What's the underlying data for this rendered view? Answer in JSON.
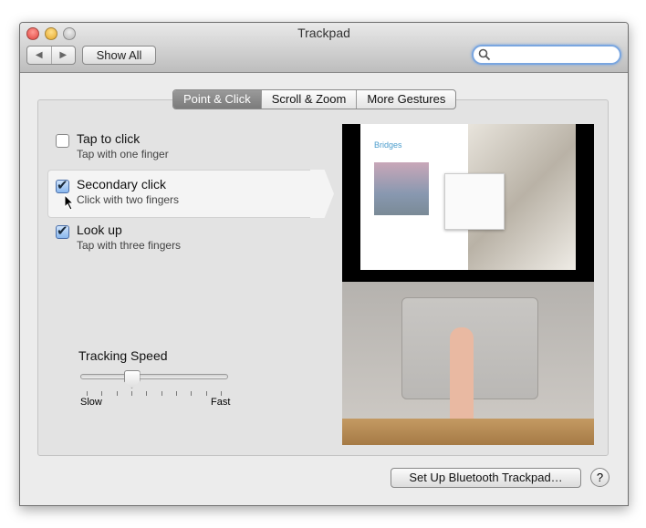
{
  "window": {
    "title": "Trackpad",
    "show_all": "Show All",
    "search_placeholder": ""
  },
  "tabs": [
    {
      "label": "Point & Click",
      "selected": true
    },
    {
      "label": "Scroll & Zoom",
      "selected": false
    },
    {
      "label": "More Gestures",
      "selected": false
    }
  ],
  "options": [
    {
      "label": "Tap to click",
      "sub": "Tap with one finger",
      "checked": false
    },
    {
      "label": "Secondary click",
      "sub": "Click with two fingers",
      "checked": true
    },
    {
      "label": "Look up",
      "sub": "Tap with three fingers",
      "checked": true
    }
  ],
  "tracking": {
    "label": "Tracking Speed",
    "min_label": "Slow",
    "max_label": "Fast",
    "ticks": 10,
    "value_fraction": 0.33
  },
  "preview": {
    "doc_title": "Bridges"
  },
  "footer": {
    "bluetooth_button": "Set Up Bluetooth Trackpad…",
    "help": "?"
  },
  "colors": {
    "accent": "#7aa6e0",
    "close": "#e0443e",
    "minimize": "#e4a72c",
    "zoom": "#b8b8b8"
  }
}
